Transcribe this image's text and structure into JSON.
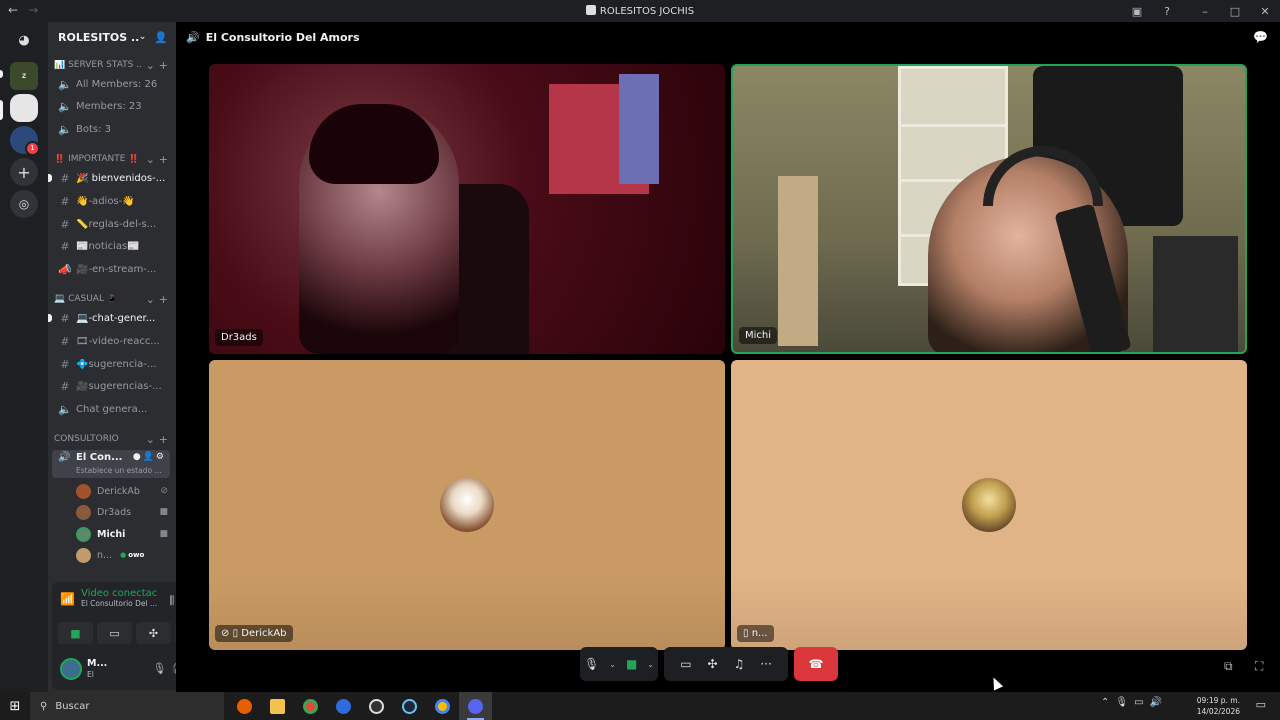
{
  "window": {
    "title": "ROLESITOS JOCHIS"
  },
  "server": {
    "name": "ROLESITOS ...",
    "rail_badge": "1"
  },
  "categories": [
    {
      "name": "📊 SERVER STATS ..."
    },
    {
      "name": "‼️ IMPORTANTE ‼️"
    },
    {
      "name": "💻 CASUAL 📱"
    },
    {
      "name": "CONSULTORIO"
    }
  ],
  "stats": [
    {
      "label": "All Members: 26"
    },
    {
      "label": "Members: 23"
    },
    {
      "label": "Bots: 3"
    }
  ],
  "important_channels": [
    {
      "label": "🎉 bienvenidos-..."
    },
    {
      "label": "👋-adios-👋"
    },
    {
      "label": "📏reglas-del-s..."
    },
    {
      "label": "📰noticias📰"
    },
    {
      "label": "🎥-en-stream-..."
    }
  ],
  "casual_channels": [
    {
      "label": "💻-chat-gener..."
    },
    {
      "label": "🎞-video-reacc..."
    },
    {
      "label": "💠sugerencia-..."
    },
    {
      "label": "🎥sugerencias-..."
    },
    {
      "label": "Chat genera..."
    }
  ],
  "active_voice": {
    "name": "El Con...",
    "status": "Establece un estado ..."
  },
  "voice_members": [
    {
      "name": "DerickAb",
      "color": "#a0522d"
    },
    {
      "name": "Dr3ads",
      "color": "#8b5a3c"
    },
    {
      "name": "Michi",
      "color": "#5a8a6a"
    },
    {
      "name": "n...",
      "color": "#c49a6c",
      "activity": "owo"
    }
  ],
  "voice_panel": {
    "status": "Video conectac",
    "channel": "El Consultorio Del ..."
  },
  "user_panel": {
    "name": "M...",
    "status": "El"
  },
  "main": {
    "channel_title": "El Consultorio Del Amors"
  },
  "tiles": [
    {
      "name": "Dr3ads"
    },
    {
      "name": "Michi"
    },
    {
      "name": "DerickAb"
    },
    {
      "name": "n..."
    }
  ],
  "taskbar": {
    "search_placeholder": "Buscar",
    "time": "09:19 p. m.",
    "date": "14/02/2026"
  },
  "colors": {
    "accent_green": "#23a559",
    "end_call": "#da373c"
  },
  "icons": [
    "discord-icon",
    "speaker-icon",
    "hashtag-icon",
    "chat-icon",
    "mic-icon",
    "camera-icon",
    "screen-share-icon",
    "activity-icon",
    "soundboard-icon",
    "more-icon",
    "hang-up-icon",
    "popout-icon",
    "fullscreen-icon",
    "windows-icon",
    "search-icon"
  ]
}
